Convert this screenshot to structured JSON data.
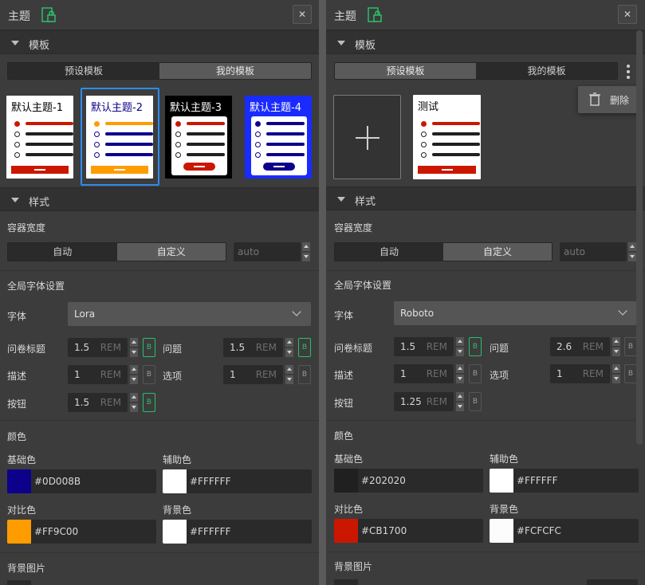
{
  "left": {
    "title": "主题",
    "close": "✕",
    "template_section": "模板",
    "tabs": [
      {
        "label": "预设模板"
      },
      {
        "label": "我的模板"
      }
    ],
    "themes": [
      {
        "name": "默认主题-1",
        "bg": "#FFFFFF",
        "text": "#000000",
        "accent": "#CB1700",
        "line": "#202020"
      },
      {
        "name": "默认主题-2",
        "bg": "#FFFFFF",
        "text": "#0D008B",
        "accent": "#FF9C00",
        "line": "#0D008B"
      },
      {
        "name": "默认主题-3",
        "bg": "#000000",
        "text": "#FFFFFF",
        "accent": "#CB1700",
        "line": "#202020"
      },
      {
        "name": "默认主题-4",
        "bg": "#1A2BFF",
        "text": "#FFFFFF",
        "accent": "#0D008B",
        "line": "#0D008B"
      }
    ],
    "style_section": "样式",
    "container_width_label": "容器宽度",
    "width_modes": [
      {
        "label": "自动"
      },
      {
        "label": "自定义"
      }
    ],
    "width_placeholder": "auto",
    "global_font_label": "全局字体设置",
    "font_label": "字体",
    "font_value": "Lora",
    "sizes": {
      "survey_title": {
        "label": "问卷标题",
        "value": "1.5",
        "unit": "REM",
        "bold": "B"
      },
      "question": {
        "label": "问题",
        "value": "1.5",
        "unit": "REM",
        "bold": "B"
      },
      "description": {
        "label": "描述",
        "value": "1",
        "unit": "REM",
        "bold": "B"
      },
      "option": {
        "label": "选项",
        "value": "1",
        "unit": "REM",
        "bold": "B"
      },
      "button": {
        "label": "按钮",
        "value": "1.5",
        "unit": "REM",
        "bold": "B"
      }
    },
    "color_section": "颜色",
    "colors": {
      "base": {
        "label": "基础色",
        "hex": "#0D008B"
      },
      "secondary": {
        "label": "辅助色",
        "hex": "#FFFFFF"
      },
      "contrast": {
        "label": "对比色",
        "hex": "#FF9C00"
      },
      "background": {
        "label": "背景色",
        "hex": "#FFFFFF"
      }
    },
    "bg_image_label": "背景图片"
  },
  "right": {
    "title": "主题",
    "close": "✕",
    "template_section": "模板",
    "tabs": [
      {
        "label": "预设模板"
      },
      {
        "label": "我的模板"
      }
    ],
    "my_template": {
      "name": "测试",
      "bg": "#FFFFFF",
      "text": "#000000",
      "accent": "#CB1700",
      "line": "#202020"
    },
    "context_menu": {
      "delete": "删除"
    },
    "style_section": "样式",
    "container_width_label": "容器宽度",
    "width_modes": [
      {
        "label": "自动"
      },
      {
        "label": "自定义"
      }
    ],
    "width_placeholder": "auto",
    "global_font_label": "全局字体设置",
    "font_label": "字体",
    "font_value": "Roboto",
    "sizes": {
      "survey_title": {
        "label": "问卷标题",
        "value": "1.5",
        "unit": "REM",
        "bold": "B"
      },
      "question": {
        "label": "问题",
        "value": "2.6",
        "unit": "REM",
        "bold": "B"
      },
      "description": {
        "label": "描述",
        "value": "1",
        "unit": "REM",
        "bold": "B"
      },
      "option": {
        "label": "选项",
        "value": "1",
        "unit": "REM",
        "bold": "B"
      },
      "button": {
        "label": "按钮",
        "value": "1.25",
        "unit": "REM",
        "bold": "B"
      }
    },
    "color_section": "颜色",
    "colors": {
      "base": {
        "label": "基础色",
        "hex": "#202020"
      },
      "secondary": {
        "label": "辅助色",
        "hex": "#FFFFFF"
      },
      "contrast": {
        "label": "对比色",
        "hex": "#CB1700"
      },
      "background": {
        "label": "背景色",
        "hex": "#FCFCFC"
      }
    },
    "bg_image_label": "背景图片"
  },
  "ui_colors": {
    "accent_green": "#2BBF6A",
    "selection_blue": "#2D8CF0"
  }
}
